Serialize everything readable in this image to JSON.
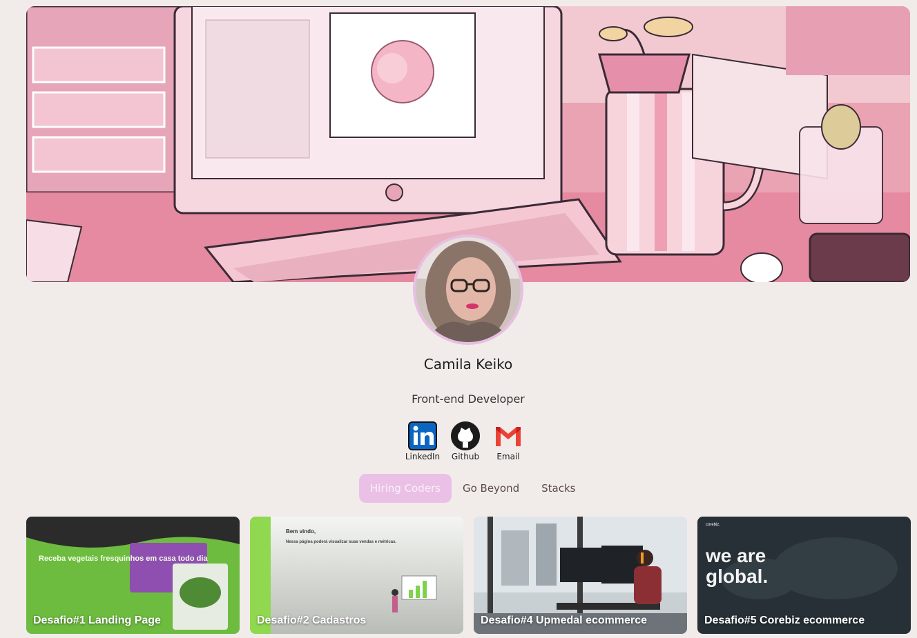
{
  "profile": {
    "name": "Camila Keiko",
    "role": "Front-end Developer"
  },
  "socials": [
    {
      "label": "LinkedIn",
      "icon": "linkedin-icon"
    },
    {
      "label": "Github",
      "icon": "github-icon"
    },
    {
      "label": "Email",
      "icon": "gmail-icon"
    }
  ],
  "tabs": [
    {
      "label": "Hiring Coders",
      "active": true
    },
    {
      "label": "Go Beyond",
      "active": false
    },
    {
      "label": "Stacks",
      "active": false
    }
  ],
  "projects": [
    {
      "title": "Desafio#1 Landing Page",
      "preview": {
        "heading": "Receba vegetais fresquinhos em casa todo dia"
      }
    },
    {
      "title": "Desafio#2 Cadastros",
      "preview": {
        "heading": "Bem vindo,",
        "subheading": "Nessa página poderá visualizar suas vendas e métricas."
      }
    },
    {
      "title": "Desafio#4 Upmedal ecommerce",
      "preview": {}
    },
    {
      "title": "Desafio#5 Corebiz ecommerce",
      "preview": {
        "brand": "corebiz.",
        "heading_line1": "we are",
        "heading_line2": "global."
      }
    }
  ],
  "colors": {
    "background": "#f1ecea",
    "accent": "#ebc0e6",
    "avatar_border": "#e7bfe1"
  }
}
